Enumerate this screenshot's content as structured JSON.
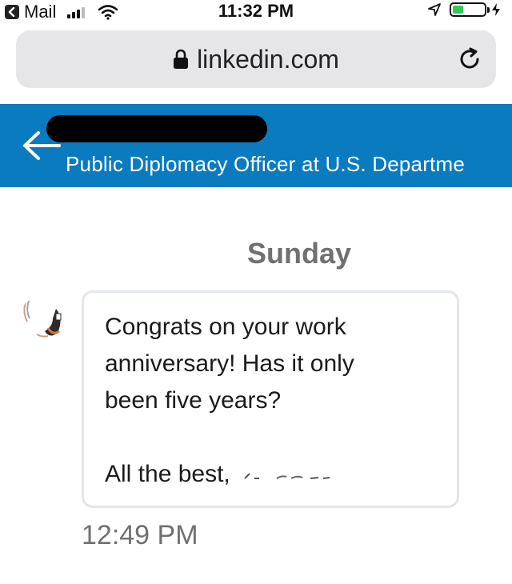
{
  "status_bar": {
    "back_app_label": "Mail",
    "time": "11:32 PM",
    "battery_level": 0.35,
    "battery_color": "#34c759"
  },
  "browser": {
    "url": "linkedin.com",
    "icons": [
      "lock-icon",
      "reload-icon"
    ]
  },
  "header": {
    "title": "Public Diplomacy Officer at U.S. Departme",
    "background": "#0b7bbf",
    "icons": [
      "back-arrow-icon"
    ]
  },
  "conversation": {
    "day_label": "Sunday",
    "message": {
      "lines": [
        "Congrats on your work",
        "anniversary! Has it only",
        "been five years?",
        "All the best,"
      ],
      "timestamp": "12:49 PM"
    }
  }
}
